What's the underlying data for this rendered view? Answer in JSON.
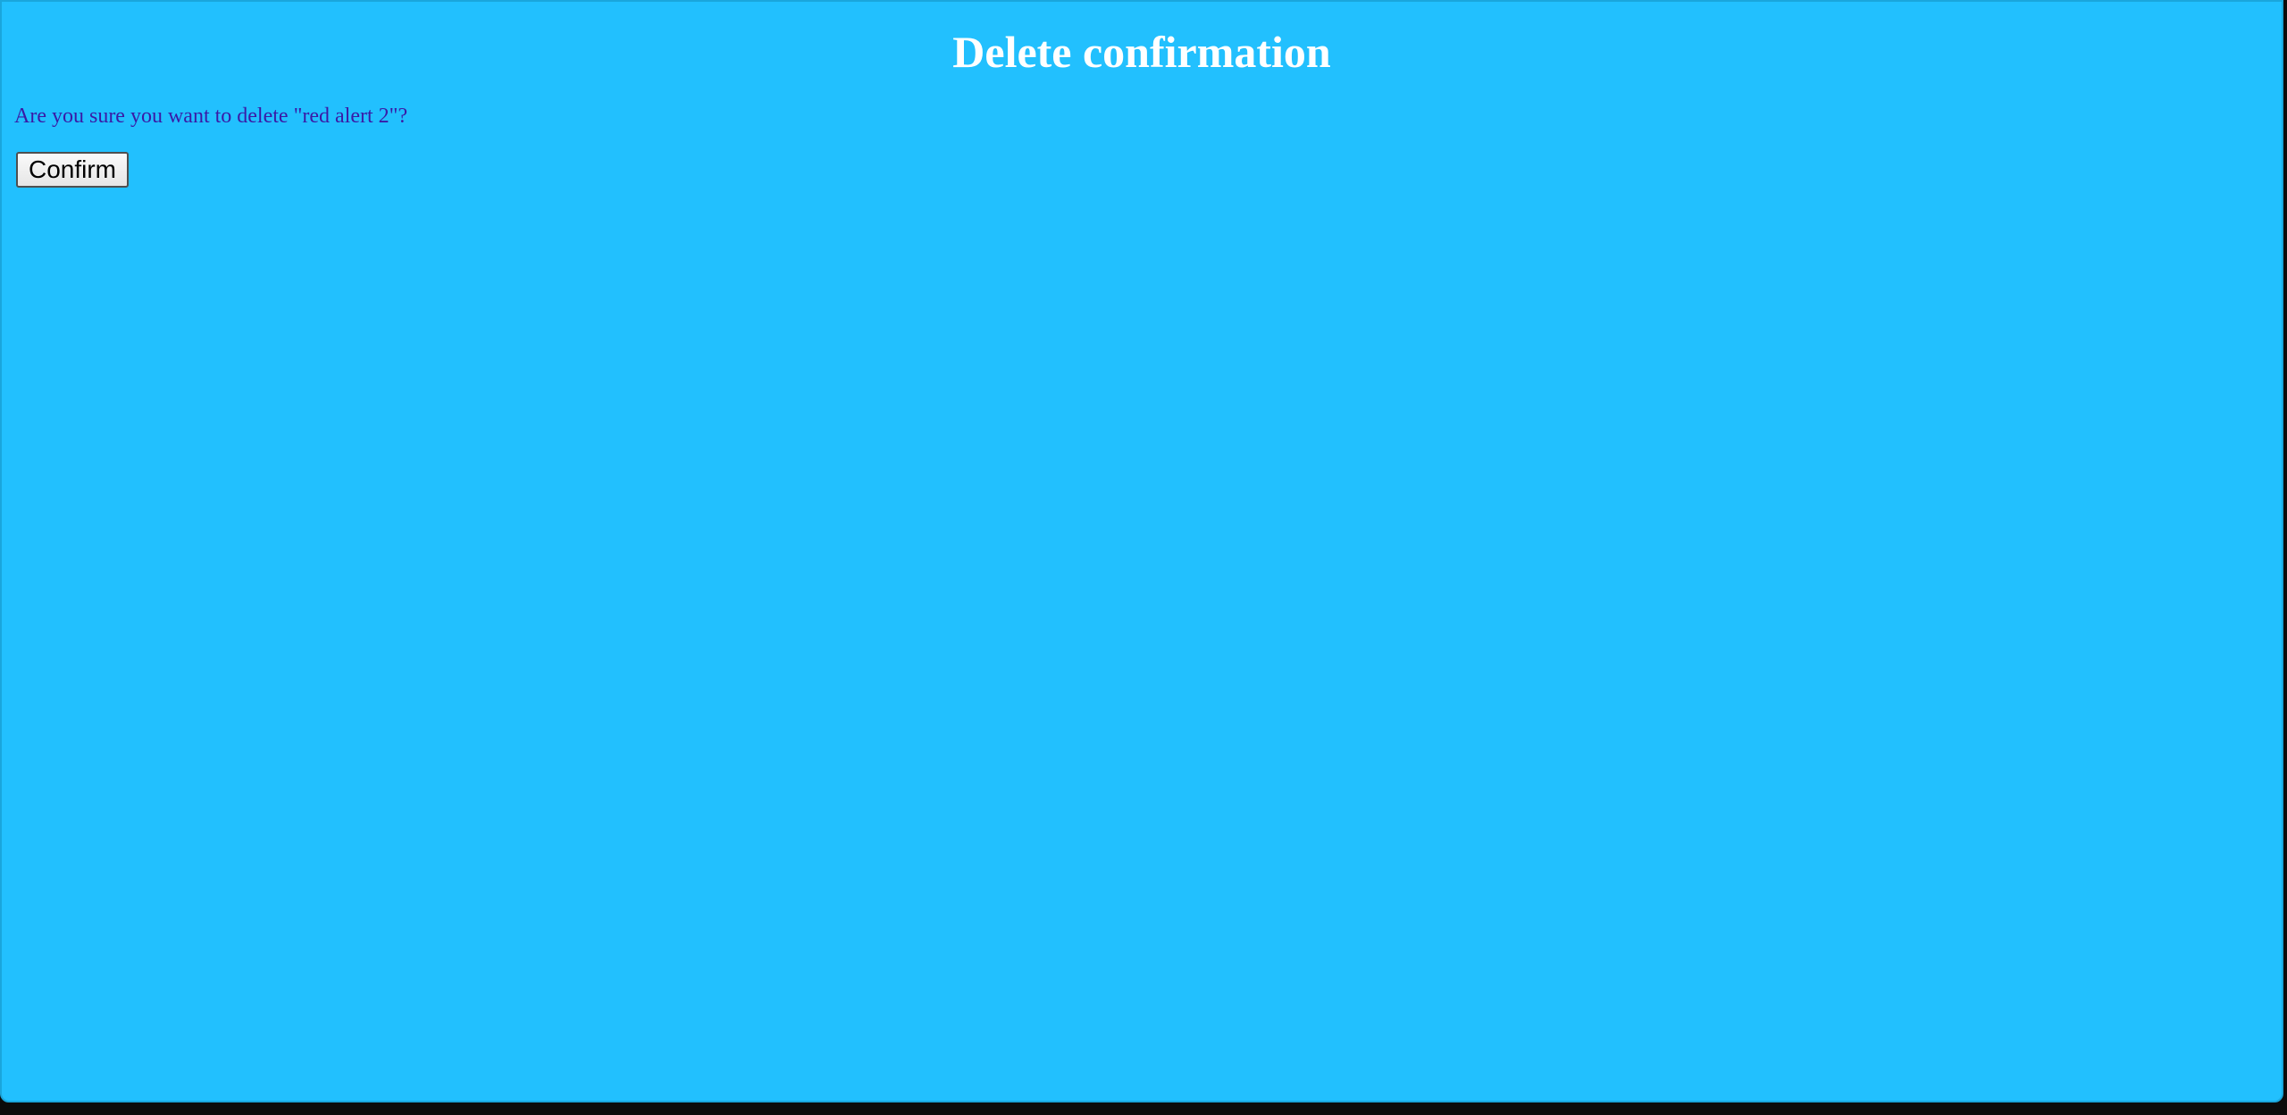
{
  "dialog": {
    "title": "Delete confirmation",
    "message": "Are you sure you want to delete \"red alert 2\"?",
    "confirm_label": "Confirm"
  },
  "colors": {
    "background": "#22c0fe",
    "title": "#ffffff",
    "message": "#3a1aa6",
    "frame": "#0b0b0b"
  }
}
